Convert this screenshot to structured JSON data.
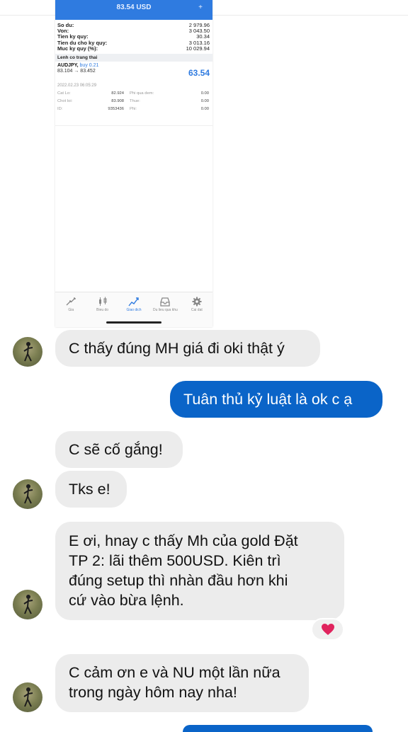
{
  "shared_screenshot": {
    "header_title": "83.54 USD",
    "header_action": "+",
    "account_rows": [
      {
        "label": "So du:",
        "value": "2 979.96"
      },
      {
        "label": "Von:",
        "value": "3 043.50"
      },
      {
        "label": "Tien ky quy:",
        "value": "30.34"
      },
      {
        "label": "Tien du cho ky quy:",
        "value": "3 013.16"
      },
      {
        "label": "Muc ky quy (%):",
        "value": "10 029.94"
      }
    ],
    "section_title": "Lenh co trang thai",
    "order": {
      "symbol": "AUDJPY,",
      "side": "buy 0.21",
      "prices": "83.104 → 83.452",
      "profit": "63.54",
      "date": "2022.02.23 06:05:29"
    },
    "details": [
      {
        "label": "Cat Lo:",
        "value": "82.924",
        "label2": "Phi qua dem:",
        "value2": "0.00"
      },
      {
        "label": "Chot loi:",
        "value": "83.908",
        "label2": "Thue:",
        "value2": "0.00"
      },
      {
        "label": "ID:",
        "value": "9353436",
        "label2": "Phi:",
        "value2": "0.00"
      }
    ],
    "tabs": [
      {
        "label": "Gia",
        "icon": "price-arrows-icon"
      },
      {
        "label": "Bieu do",
        "icon": "candlestick-chart-icon"
      },
      {
        "label": "Giao dich",
        "icon": "trade-line-chart-icon"
      },
      {
        "label": "Du lieu qua khu",
        "icon": "inbox-history-icon"
      },
      {
        "label": "Cai dat",
        "icon": "gear-icon"
      }
    ]
  },
  "messages": [
    {
      "side": "in",
      "text": "C thấy đúng MH giá đi oki thật ý"
    },
    {
      "side": "out",
      "text": "Tuân thủ kỷ luật là ok c ạ"
    },
    {
      "side": "in",
      "text": "C sẽ cố gắng!"
    },
    {
      "side": "in",
      "text": "Tks e!"
    },
    {
      "side": "in",
      "lines": [
        "E ơi, hnay c thấy Mh của gold Đặt",
        "TP 2: lãi thêm 500USD. Kiên trì",
        "đúng setup thì nhàn đầu hơn khi",
        "cứ vào bừa lệnh."
      ]
    },
    {
      "side": "in",
      "lines": [
        "C cảm ơn e và NU một lần nữa",
        "trong ngày hôm nay nha!"
      ]
    }
  ],
  "reaction": {
    "icon": "heart-icon",
    "color": "#e0245e"
  },
  "colors": {
    "accent": "#2f7be0",
    "outgoing_bubble": "#0a64c8",
    "incoming_bubble": "#ececec"
  }
}
